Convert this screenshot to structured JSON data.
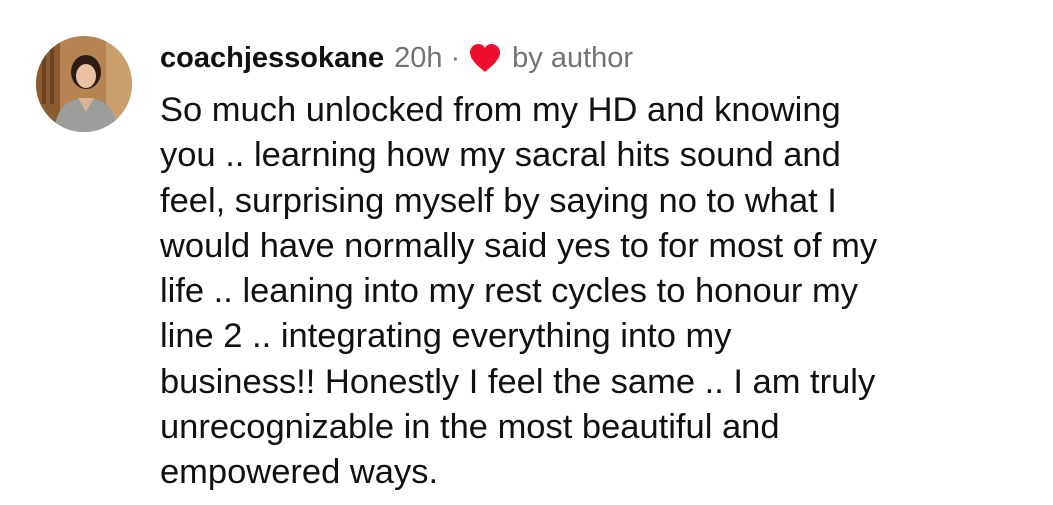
{
  "comment": {
    "username": "coachjessokane",
    "time": "20h",
    "separator": "·",
    "heart_icon": "heart-icon",
    "heart_color": "#ed0e2d",
    "liked_label": "by author",
    "text_lines": [
      "So much unlocked from my HD and knowing",
      "you .. learning how my sacral hits sound and",
      "feel, surprising myself by saying no to what I",
      "would have normally said yes to for most of my",
      "life .. leaning into my rest cycles to honour my",
      "line 2 .. integrating everything into my",
      "business!! Honestly I feel the same .. I am truly",
      "unrecognizable in the most beautiful and",
      "empowered ways."
    ]
  }
}
